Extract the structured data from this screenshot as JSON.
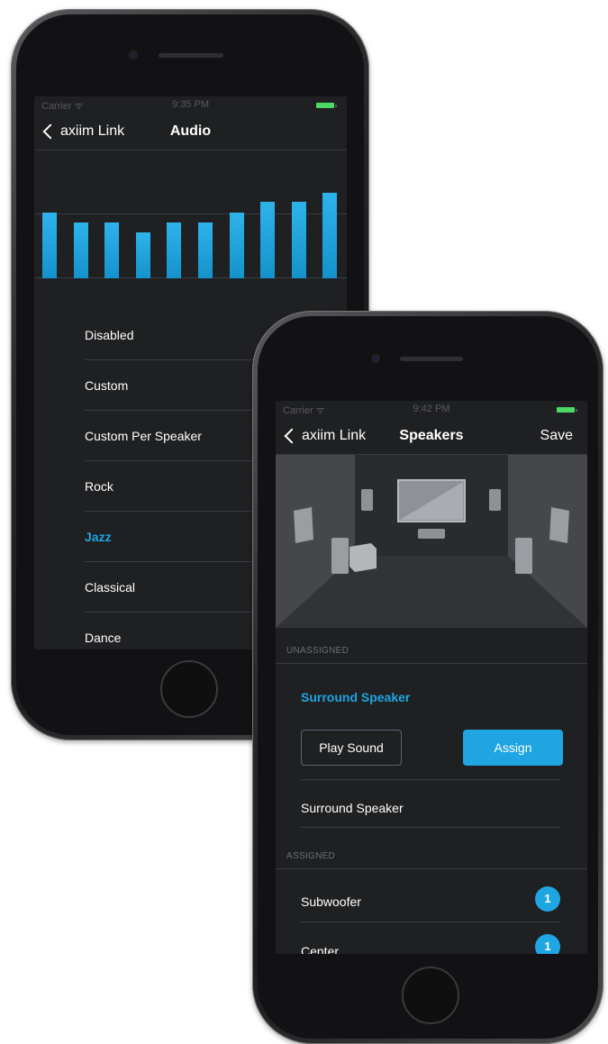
{
  "audio_screen": {
    "status": {
      "carrier": "Carrier ᯤ",
      "time": "9:35 PM"
    },
    "nav": {
      "back_label": "axiim Link",
      "title": "Audio"
    },
    "eq_levels": [
      0.72,
      0.61,
      0.61,
      0.5,
      0.61,
      0.61,
      0.72,
      0.84,
      0.84,
      0.94
    ],
    "presets": [
      {
        "label": "Disabled",
        "selected": false
      },
      {
        "label": "Custom",
        "selected": false
      },
      {
        "label": "Custom Per Speaker",
        "selected": false
      },
      {
        "label": "Rock",
        "selected": false
      },
      {
        "label": "Jazz",
        "selected": true
      },
      {
        "label": "Classical",
        "selected": false
      },
      {
        "label": "Dance",
        "selected": false
      }
    ]
  },
  "speakers_screen": {
    "status": {
      "carrier": "Carrier ᯤ",
      "time": "9:42 PM"
    },
    "nav": {
      "back_label": "axiim Link",
      "title": "Speakers",
      "save_label": "Save"
    },
    "unassigned": {
      "section_label": "UNASSIGNED",
      "selected_label": "Surround Speaker",
      "play_sound_label": "Play Sound",
      "assign_label": "Assign",
      "items": [
        "Surround Speaker"
      ]
    },
    "assigned": {
      "section_label": "ASSIGNED",
      "items": [
        {
          "label": "Subwoofer",
          "count": "1"
        },
        {
          "label": "Center",
          "count": "1"
        }
      ]
    }
  },
  "colors": {
    "accent": "#1ea5e2",
    "screen_bg": "#1f2022",
    "battery": "#4cd964"
  }
}
